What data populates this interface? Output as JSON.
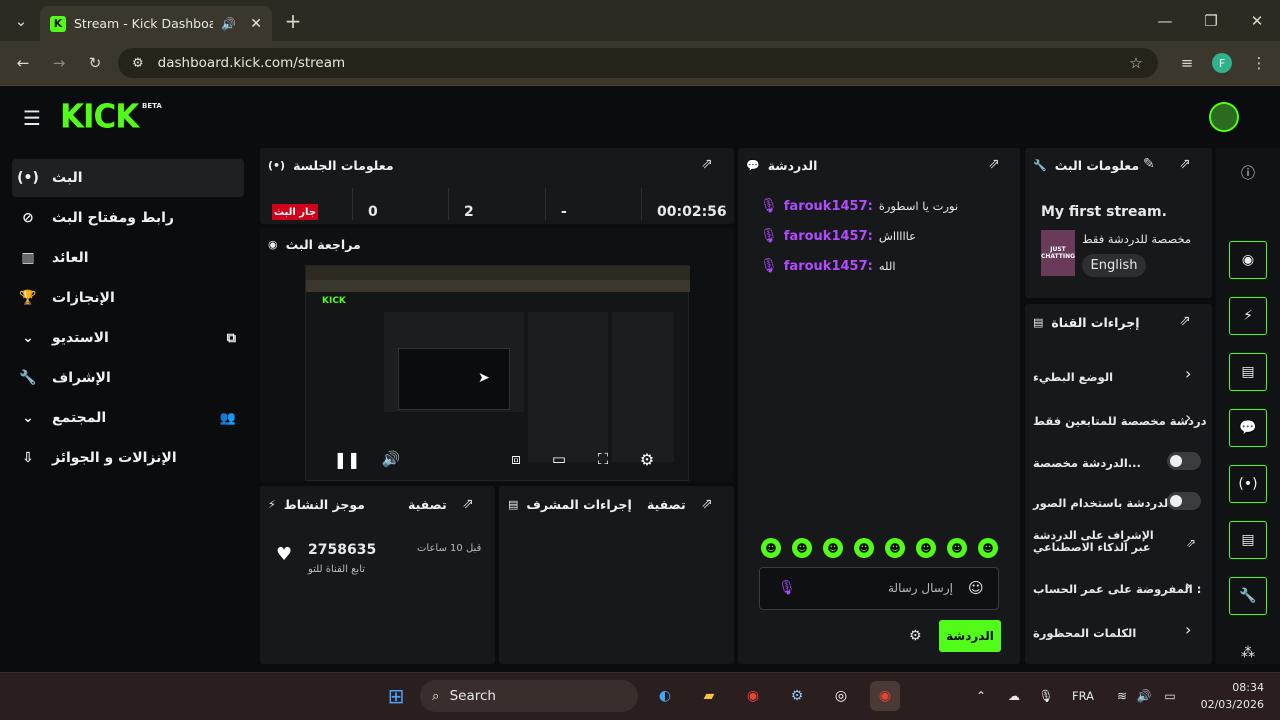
{
  "browser": {
    "tab_title": "Stream - Kick Dashboard",
    "url": "dashboard.kick.com/stream",
    "profile_initial": "F"
  },
  "kick": {
    "logo": "KICK",
    "beta": "BETA"
  },
  "sidebar": {
    "items": [
      {
        "label": "البث",
        "icon": "broadcast-icon"
      },
      {
        "label": "رابط ومفتاح البث",
        "icon": "link-icon"
      },
      {
        "label": "العائد",
        "icon": "revenue-icon"
      },
      {
        "label": "الإنجازات",
        "icon": "trophy-icon"
      },
      {
        "label": "الاستديو",
        "icon": "studio-icon"
      },
      {
        "label": "الإشراف",
        "icon": "wrench-icon"
      },
      {
        "label": "المجتمع",
        "icon": "community-icon"
      },
      {
        "label": "الإنزالات و الجوائز",
        "icon": "drops-icon"
      }
    ]
  },
  "session": {
    "title": "معلومات الجلسة",
    "live_badge": "جار البث",
    "viewers": "0",
    "followers": "2",
    "dash": "-",
    "duration": "00:02:56"
  },
  "preview": {
    "title": "مراجعة البث"
  },
  "activity": {
    "title": "موجز النشاط",
    "filter": "تصفية",
    "count": "2758635",
    "time": "قبل 10 ساعات",
    "desc": "تابع القناة للتو"
  },
  "modactions": {
    "title": "إجراءات المشرف",
    "filter": "تصفية"
  },
  "chat": {
    "title": "الدردشة",
    "messages": [
      {
        "user": "farouk1457:",
        "text": "نورت يا اسطورة"
      },
      {
        "user": "farouk1457:",
        "text": "عاااااش"
      },
      {
        "user": "farouk1457:",
        "text": "الله"
      }
    ],
    "input_placeholder": "إرسال رسالة",
    "send_button": "الدردشة"
  },
  "streaminfo": {
    "title": "معلومات البث",
    "stream_title": "My first stream.",
    "category": "مخصصة للدردشة فقط",
    "language": "English",
    "category_thumb_text": "JUST CHATTING"
  },
  "channel": {
    "title": "إجراءات القناة",
    "items": [
      {
        "label": "الوضع البطيء"
      },
      {
        "label": "دردشة مخصصة للمتابعين فقط"
      },
      {
        "label": "الدردشة مخصصة..."
      },
      {
        "label": "الدردشة باستخدام الصور..."
      },
      {
        "label": "الإشراف على الدردشة عبر الذكاء الاصطناعي"
      },
      {
        "label": "المفروضة على عمر الحساب :"
      },
      {
        "label": "الكلمات المحظورة"
      }
    ]
  },
  "taskbar": {
    "search": "Search",
    "lang": "FRA",
    "time": "08:34",
    "date": "02/03/2026"
  },
  "colors": {
    "accent": "#53fc18",
    "live": "#d0021b",
    "chat_user": "#b04bff"
  }
}
